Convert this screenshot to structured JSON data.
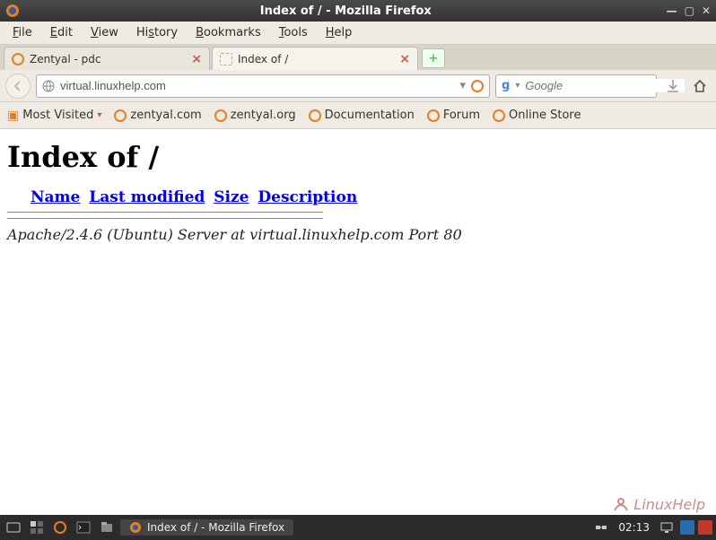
{
  "window": {
    "title": "Index of / - Mozilla Firefox"
  },
  "menubar": [
    {
      "label": "File",
      "ul": "F"
    },
    {
      "label": "Edit",
      "ul": "E"
    },
    {
      "label": "View",
      "ul": "V"
    },
    {
      "label": "History",
      "ul": "s"
    },
    {
      "label": "Bookmarks",
      "ul": "B"
    },
    {
      "label": "Tools",
      "ul": "T"
    },
    {
      "label": "Help",
      "ul": "H"
    }
  ],
  "tabs": [
    {
      "title": "Zentyal - pdc"
    },
    {
      "title": "Index of /"
    }
  ],
  "urlbar": {
    "value": "virtual.linuxhelp.com"
  },
  "searchbar": {
    "engine": "g",
    "placeholder": "Google"
  },
  "bookmarks": [
    {
      "label": "Most Visited",
      "dd": true,
      "folder": true
    },
    {
      "label": "zentyal.com"
    },
    {
      "label": "zentyal.org"
    },
    {
      "label": "Documentation"
    },
    {
      "label": "Forum"
    },
    {
      "label": "Online Store"
    }
  ],
  "page": {
    "heading": "Index of /",
    "columns": [
      "Name",
      "Last modified",
      "Size",
      "Description"
    ],
    "server_line": "Apache/2.4.6 (Ubuntu) Server at virtual.linuxhelp.com Port 80"
  },
  "watermark": "LinuxHelp",
  "taskbar": {
    "active_task": "Index of / - Mozilla Firefox",
    "clock": "02:13"
  }
}
